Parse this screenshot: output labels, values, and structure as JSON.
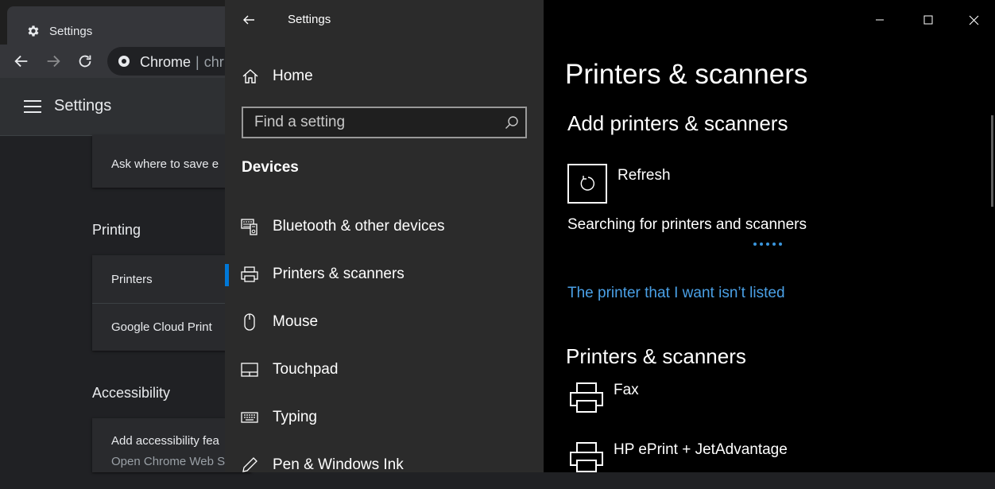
{
  "chrome": {
    "tab": {
      "title": "Settings",
      "icon": "gear-icon"
    },
    "omnibox": {
      "site": "Chrome",
      "separator": "|",
      "url": "chr"
    },
    "header": {
      "title": "Settings"
    },
    "downloads": {
      "ask_label": "Ask where to save e"
    },
    "printing": {
      "section": "Printing",
      "items": [
        {
          "label": "Printers"
        },
        {
          "label": "Google Cloud Print"
        }
      ]
    },
    "accessibility": {
      "section": "Accessibility",
      "item_title": "Add accessibility fea",
      "item_sub": "Open Chrome Web S"
    }
  },
  "settings": {
    "window_title": "Settings",
    "home_label": "Home",
    "search": {
      "placeholder": "Find a setting"
    },
    "section": "Devices",
    "nav_items": [
      {
        "label": "Bluetooth & other devices",
        "icon": "bluetooth-devices-icon",
        "selected": false
      },
      {
        "label": "Printers & scanners",
        "icon": "printer-icon",
        "selected": true
      },
      {
        "label": "Mouse",
        "icon": "mouse-icon",
        "selected": false
      },
      {
        "label": "Touchpad",
        "icon": "touchpad-icon",
        "selected": false
      },
      {
        "label": "Typing",
        "icon": "keyboard-icon",
        "selected": false
      },
      {
        "label": "Pen & Windows Ink",
        "icon": "pen-icon",
        "selected": false
      }
    ],
    "page": {
      "title": "Printers & scanners",
      "add_heading": "Add printers & scanners",
      "refresh_label": "Refresh",
      "searching_text": "Searching for printers and scanners",
      "not_listed_link": "The printer that I want isn’t listed",
      "list_heading": "Printers & scanners",
      "printers": [
        {
          "name": "Fax"
        },
        {
          "name": "HP ePrint + JetAdvantage"
        }
      ]
    },
    "colors": {
      "accent": "#0078d7",
      "link": "#4aa0e6",
      "nav_bg": "#2b2b2b",
      "content_bg": "#000000"
    }
  }
}
